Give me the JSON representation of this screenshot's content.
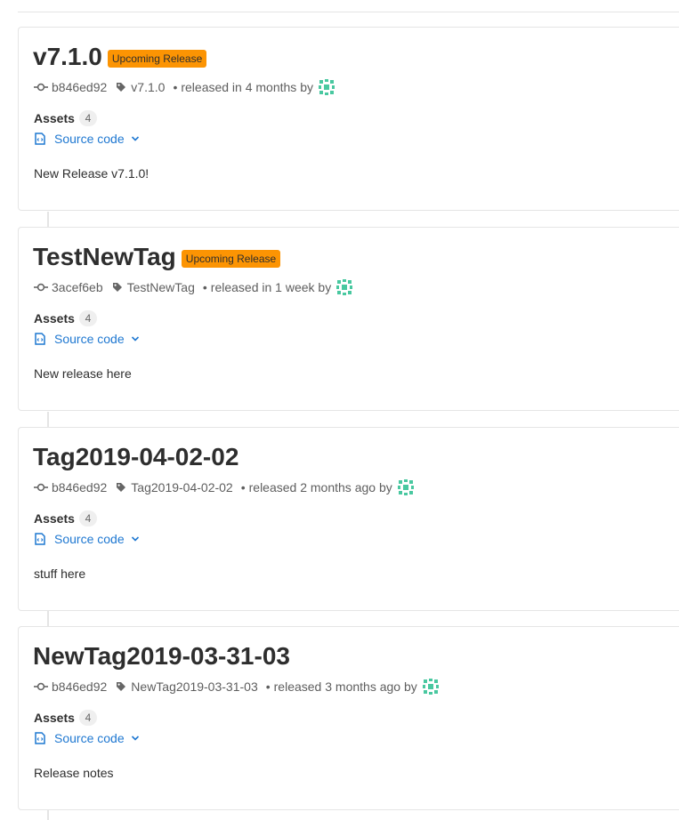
{
  "releases": [
    {
      "title": "v7.1.0",
      "badge": "Upcoming Release",
      "commit": "b846ed92",
      "tag": "v7.1.0",
      "released": "released in 4 months by",
      "assets_label": "Assets",
      "assets_count": "4",
      "source_label": "Source code",
      "notes": "New Release v7.1.0!"
    },
    {
      "title": "TestNewTag",
      "badge": "Upcoming Release",
      "commit": "3acef6eb",
      "tag": "TestNewTag",
      "released": "released in 1 week by",
      "assets_label": "Assets",
      "assets_count": "4",
      "source_label": "Source code",
      "notes": "New release here"
    },
    {
      "title": "Tag2019-04-02-02",
      "badge": "",
      "commit": "b846ed92",
      "tag": "Tag2019-04-02-02",
      "released": "released 2 months ago by",
      "assets_label": "Assets",
      "assets_count": "4",
      "source_label": "Source code",
      "notes": "stuff here"
    },
    {
      "title": "NewTag2019-03-31-03",
      "badge": "",
      "commit": "b846ed92",
      "tag": "NewTag2019-03-31-03",
      "released": "released 3 months ago by",
      "assets_label": "Assets",
      "assets_count": "4",
      "source_label": "Source code",
      "notes": "Release notes"
    }
  ],
  "icons": {
    "commit": "commit-icon",
    "tag": "tag-icon",
    "file": "doc-code-icon",
    "chevron": "chevron-down-icon",
    "avatar": "identicon-avatar"
  },
  "colors": {
    "badge": "#fc9403",
    "link": "#1f78d1",
    "border": "#e5e5e5",
    "avatar": "#49c8a0"
  }
}
